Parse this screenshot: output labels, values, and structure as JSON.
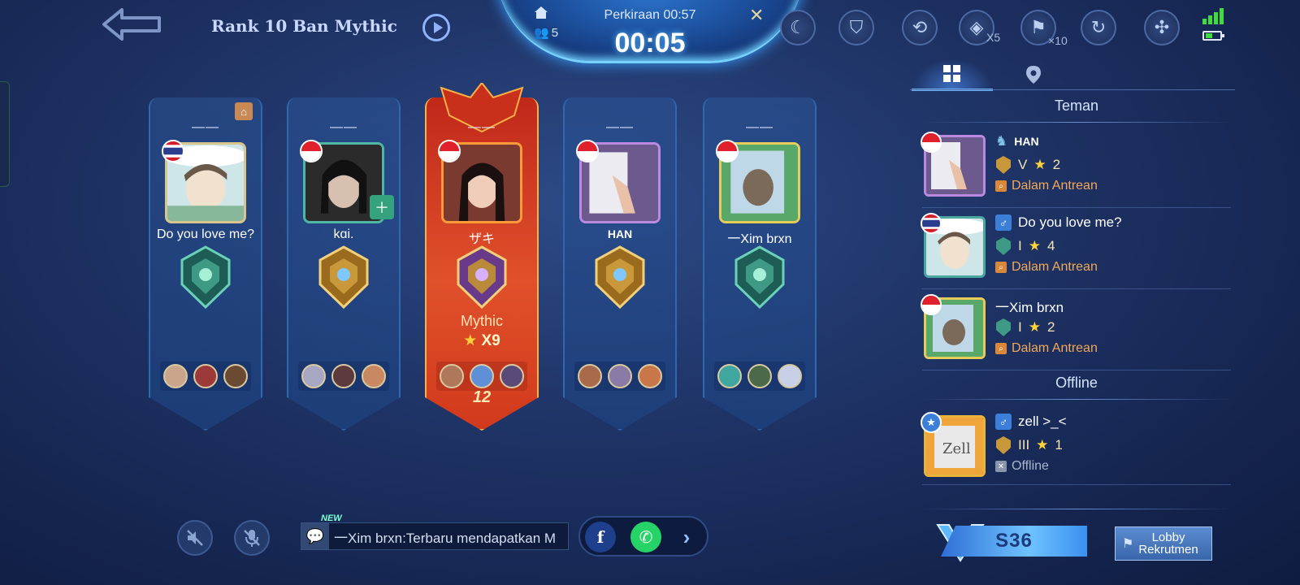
{
  "header": {
    "title": "Rank 10 Ban Mythic",
    "party_count": "5",
    "estimate": "Perkiraan 00:57",
    "countdown": "00:05",
    "cancel": "✕",
    "multiplier_x5": "X5",
    "multiplier_x10": "×10"
  },
  "players": [
    {
      "dash": "——",
      "name": "Do you love me?",
      "flag": "thailand",
      "rank": "",
      "stars": ""
    },
    {
      "dash": "——",
      "name": "kɑi.",
      "flag": "indonesia",
      "rank": "",
      "stars": ""
    },
    {
      "dash": "——",
      "name": "ザキ",
      "flag": "indonesia",
      "rank": "Mythic",
      "stars": "X9",
      "badge": "12"
    },
    {
      "dash": "——",
      "name": "HAN",
      "flag": "indonesia",
      "rank": "",
      "stars": ""
    },
    {
      "dash": "——",
      "name": "一Xim brxn",
      "flag": "indonesia",
      "rank": "",
      "stars": ""
    }
  ],
  "chat": {
    "new_badge": "NEW",
    "message": "一Xim brxn:Terbaru mendapatkan M"
  },
  "right_panel": {
    "section_friends": "Teman",
    "section_offline": "Offline",
    "friends": [
      {
        "name": "HAN",
        "rank": "V",
        "stars": "2",
        "status": "Dalam Antrean"
      },
      {
        "name": "Do you love me?",
        "rank": "I",
        "stars": "4",
        "status": "Dalam Antrean"
      },
      {
        "name": "一Xim brxn",
        "rank": "I",
        "stars": "2",
        "status": "Dalam Antrean"
      }
    ],
    "offline": [
      {
        "name": "zell >_<",
        "rank": "III",
        "stars": "1",
        "status": "Offline"
      }
    ],
    "season": "S36",
    "lobby_line1": "Lobby",
    "lobby_line2": "Rekrutmen"
  },
  "colors": {
    "accent_blue": "#6fb2ff",
    "featured_red": "#d13a1c",
    "queue_orange": "#f0a85a"
  }
}
